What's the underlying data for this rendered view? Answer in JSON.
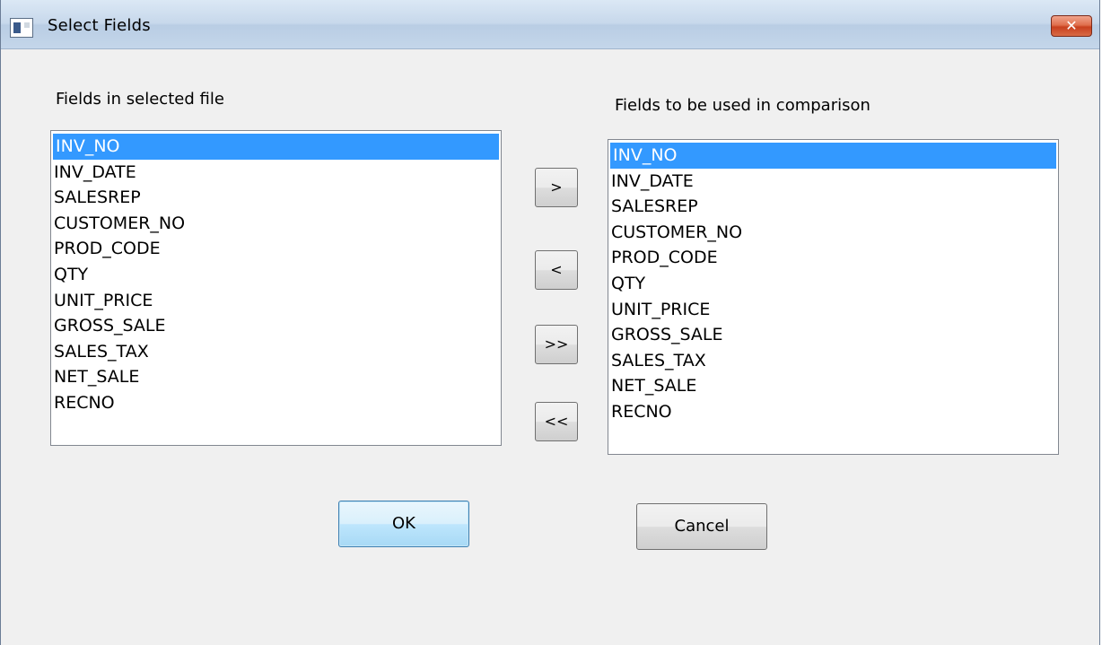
{
  "window": {
    "title": "Select Fields",
    "close_label": "✕"
  },
  "left_panel": {
    "label": "Fields in selected file",
    "items": [
      "INV_NO",
      "INV_DATE",
      "SALESREP",
      "CUSTOMER_NO",
      "PROD_CODE",
      "QTY",
      "UNIT_PRICE",
      "GROSS_SALE",
      "SALES_TAX",
      "NET_SALE",
      "RECNO"
    ],
    "selected_index": 0
  },
  "right_panel": {
    "label": "Fields to be used in comparison",
    "items": [
      "INV_NO",
      "INV_DATE",
      "SALESREP",
      "CUSTOMER_NO",
      "PROD_CODE",
      "QTY",
      "UNIT_PRICE",
      "GROSS_SALE",
      "SALES_TAX",
      "NET_SALE",
      "RECNO"
    ],
    "selected_index": 0
  },
  "transfer_buttons": {
    "add": ">",
    "remove": "<",
    "add_all": ">>",
    "remove_all": "<<"
  },
  "actions": {
    "ok": "OK",
    "cancel": "Cancel"
  },
  "colors": {
    "selection": "#3399ff",
    "close_button": "#d8502e"
  }
}
